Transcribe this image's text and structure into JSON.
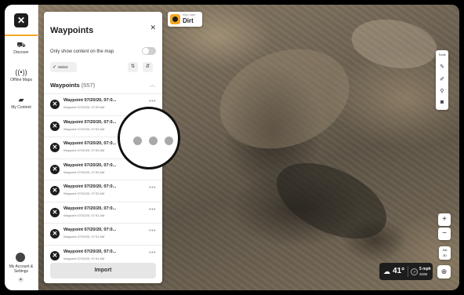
{
  "app": {
    "logo_glyph": "✕",
    "accent": "#f5a623"
  },
  "nav": {
    "items": [
      {
        "label": "Discover",
        "icon": "car-icon"
      },
      {
        "label": "Offline Maps",
        "icon": "offline-signal-icon"
      },
      {
        "label": "My Content",
        "icon": "folder-icon"
      }
    ],
    "account_label": "My Account & Settings"
  },
  "map_layer": {
    "sublabel": "Map Layer",
    "name": "Dirt"
  },
  "panel": {
    "title": "Waypoints",
    "close_glyph": "✕",
    "only_show_label": "Only show content on the map",
    "select_label": "Select",
    "section_title": "Waypoints",
    "section_count": "(557)",
    "import_label": "Import"
  },
  "waypoints": [
    {
      "name": "Waypoint 07/20/20, 07:0...",
      "sub": "Waypoint 07/20/20, 07:53 AM"
    },
    {
      "name": "Waypoint 07/20/20, 07:0...",
      "sub": "Waypoint 07/20/20, 07:53 AM"
    },
    {
      "name": "Waypoint 07/20/20, 07:0...",
      "sub": "Waypoint 07/20/20, 07:53 AM"
    },
    {
      "name": "Waypoint 07/20/20, 07:0...",
      "sub": "Waypoint 07/20/20, 07:53 AM"
    },
    {
      "name": "Waypoint 07/20/20, 07:0...",
      "sub": "Waypoint 07/20/20, 07:53 AM"
    },
    {
      "name": "Waypoint 07/20/20, 07:0...",
      "sub": "Waypoint 07/20/20, 07:51 AM"
    },
    {
      "name": "Waypoint 07/20/20, 07:0...",
      "sub": "Waypoint 07/20/20, 07:51 AM"
    },
    {
      "name": "Waypoint 07/20/20, 07:0...",
      "sub": "Waypoint 07/20/20, 07:51 AM"
    }
  ],
  "tools": {
    "label": "Tools"
  },
  "zoom": {
    "in": "+",
    "out": "−"
  },
  "map_style": {
    "line1": "Sat",
    "line2": "3D"
  },
  "weather": {
    "temp": "41°",
    "wind_speed": "5 mph",
    "wind_dir": "SSW"
  }
}
